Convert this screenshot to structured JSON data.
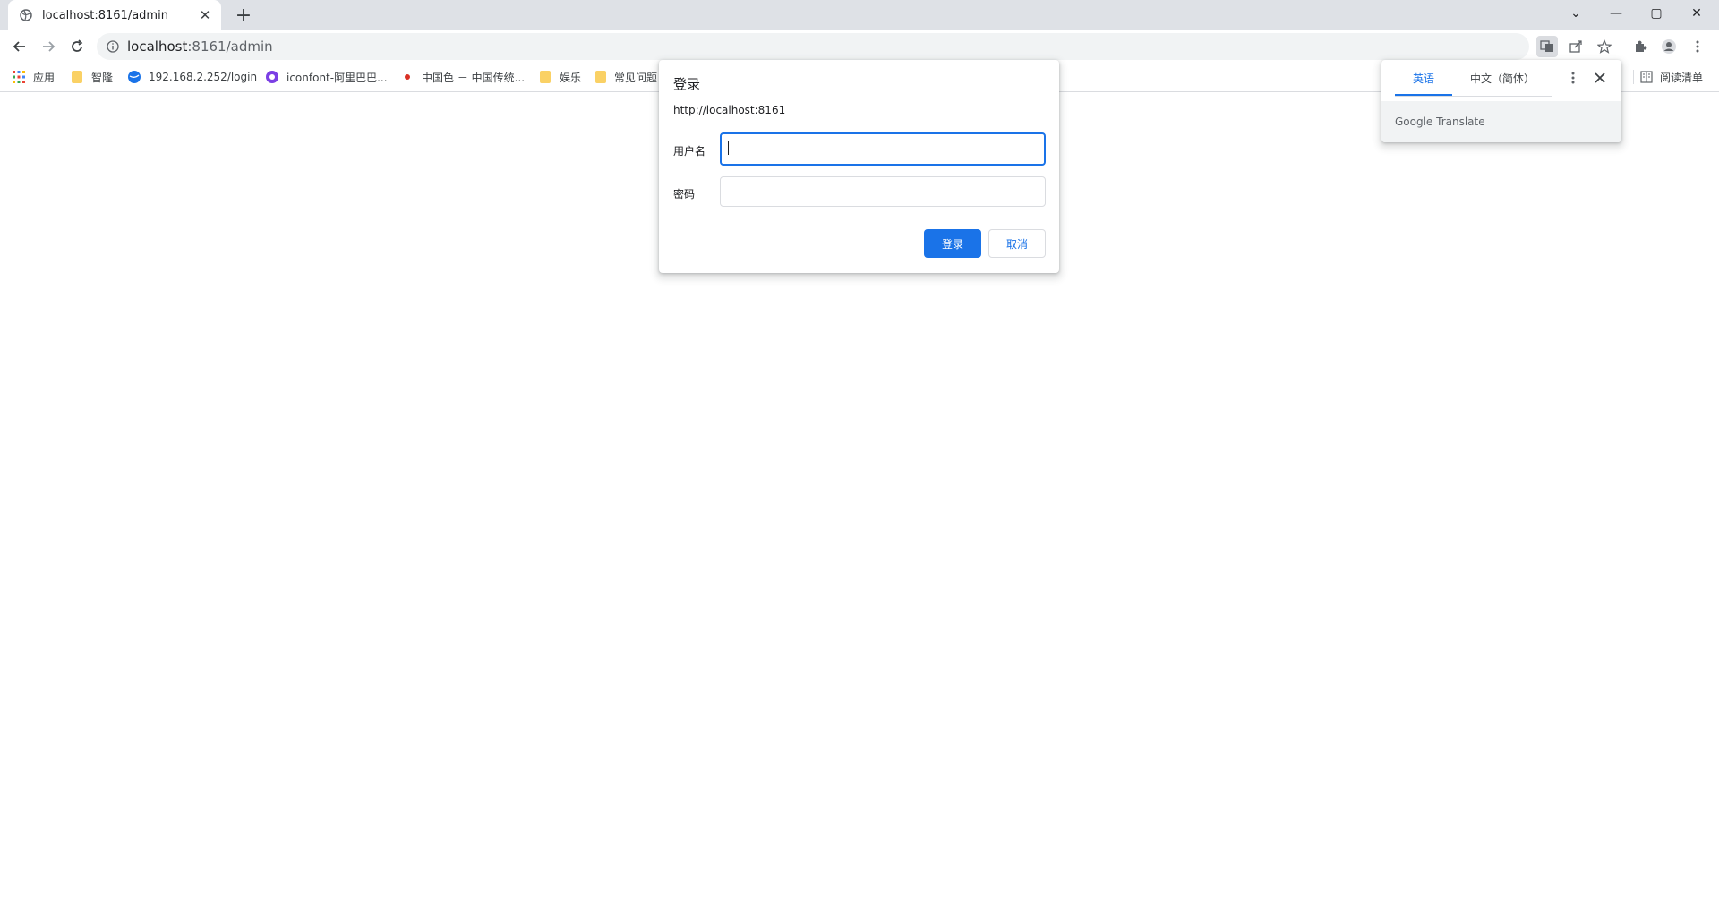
{
  "tab": {
    "title": "localhost:8161/admin",
    "close": "✕"
  },
  "newtab": "+",
  "window": {
    "chevron": "⌄",
    "minimize": "—",
    "maximize": "▢",
    "close": "✕"
  },
  "omnibox": {
    "host": "localhost",
    "path": ":8161/admin"
  },
  "bookmarks": {
    "items": [
      {
        "label": "应用"
      },
      {
        "label": "智隆"
      },
      {
        "label": "192.168.2.252/login"
      },
      {
        "label": "iconfont-阿里巴巴..."
      },
      {
        "label": "中国色 － 中国传统..."
      },
      {
        "label": "娱乐"
      },
      {
        "label": "常见问题"
      }
    ],
    "reading_list": "阅读清单"
  },
  "dialog": {
    "title": "登录",
    "origin": "http://localhost:8161",
    "username_label": "用户名",
    "username_value": "",
    "password_label": "密码",
    "password_value": "",
    "login_button": "登录",
    "cancel_button": "取消"
  },
  "translate": {
    "lang_source": "英语",
    "lang_target": "中文（简体）",
    "footer": "Google Translate"
  },
  "colors": {
    "accent": "#1a73e8",
    "folder": "#fad165"
  }
}
